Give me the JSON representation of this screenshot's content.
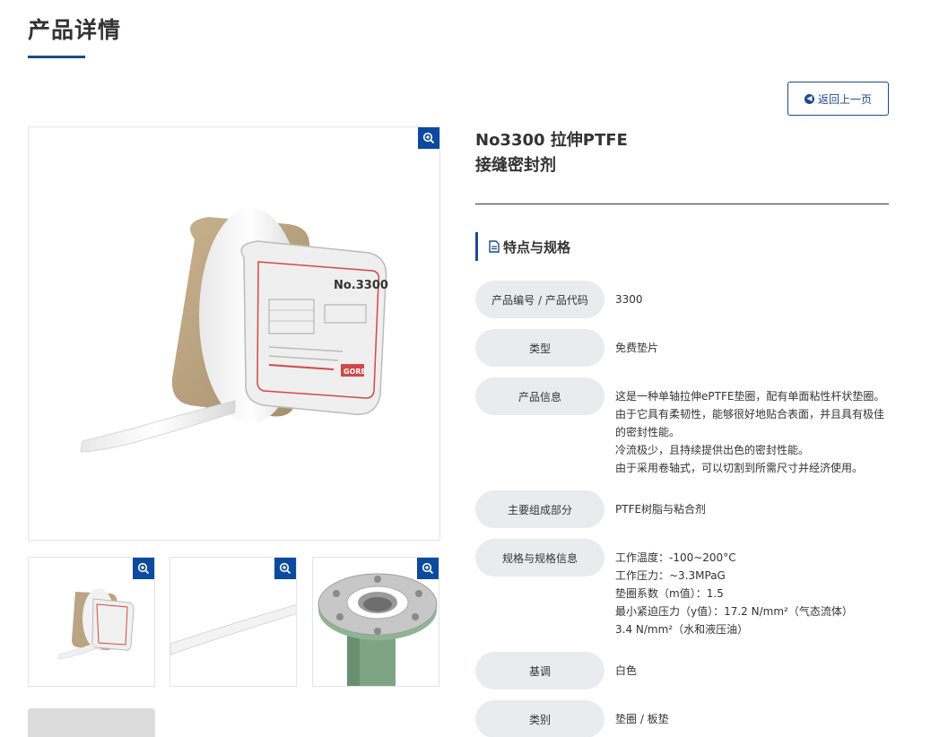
{
  "page": {
    "title": "产品详情"
  },
  "back_button": {
    "label": "返回上一页"
  },
  "product": {
    "name_line1": "No3300 拉伸PTFE",
    "name_line2": "接缝密封剂"
  },
  "section": {
    "title": "特点与规格"
  },
  "specs": [
    {
      "label": "产品编号 / 产品代码",
      "value": "3300"
    },
    {
      "label": "类型",
      "value": "免费垫片"
    },
    {
      "label": "产品信息",
      "value": "这是一种单轴拉伸ePTFE垫圈，配有单面粘性杆状垫圈。\n由于它具有柔韧性，能够很好地贴合表面，并且具有极佳\n的密封性能。\n冷流极少，且持续提供出色的密封性能。\n由于采用卷轴式，可以切割到所需尺寸并经济使用。"
    },
    {
      "label": "主要组成部分",
      "value": "PTFE树脂与粘合剂"
    },
    {
      "label": "规格与规格信息",
      "value": "工作温度：-100~200°C\n工作压力：~3.3MPaG\n垫圈系数（m值）：1.5\n最小紧迫压力（y值）：17.2 N/mm²（气态流体）\n3.4 N/mm²（水和液压油）"
    },
    {
      "label": "基调",
      "value": "白色"
    },
    {
      "label": "类别",
      "value": "垫圈 / 板垫"
    }
  ],
  "spool_label": {
    "title": "No.3300",
    "brand": "GORE"
  },
  "colors": {
    "accent": "#1d4a8c",
    "zoom_button": "#0b4a9e",
    "label_bg": "#e9ecef"
  },
  "icons": {
    "zoom": "zoom-in-icon",
    "back": "arrow-left-circle-icon",
    "section": "document-icon"
  }
}
